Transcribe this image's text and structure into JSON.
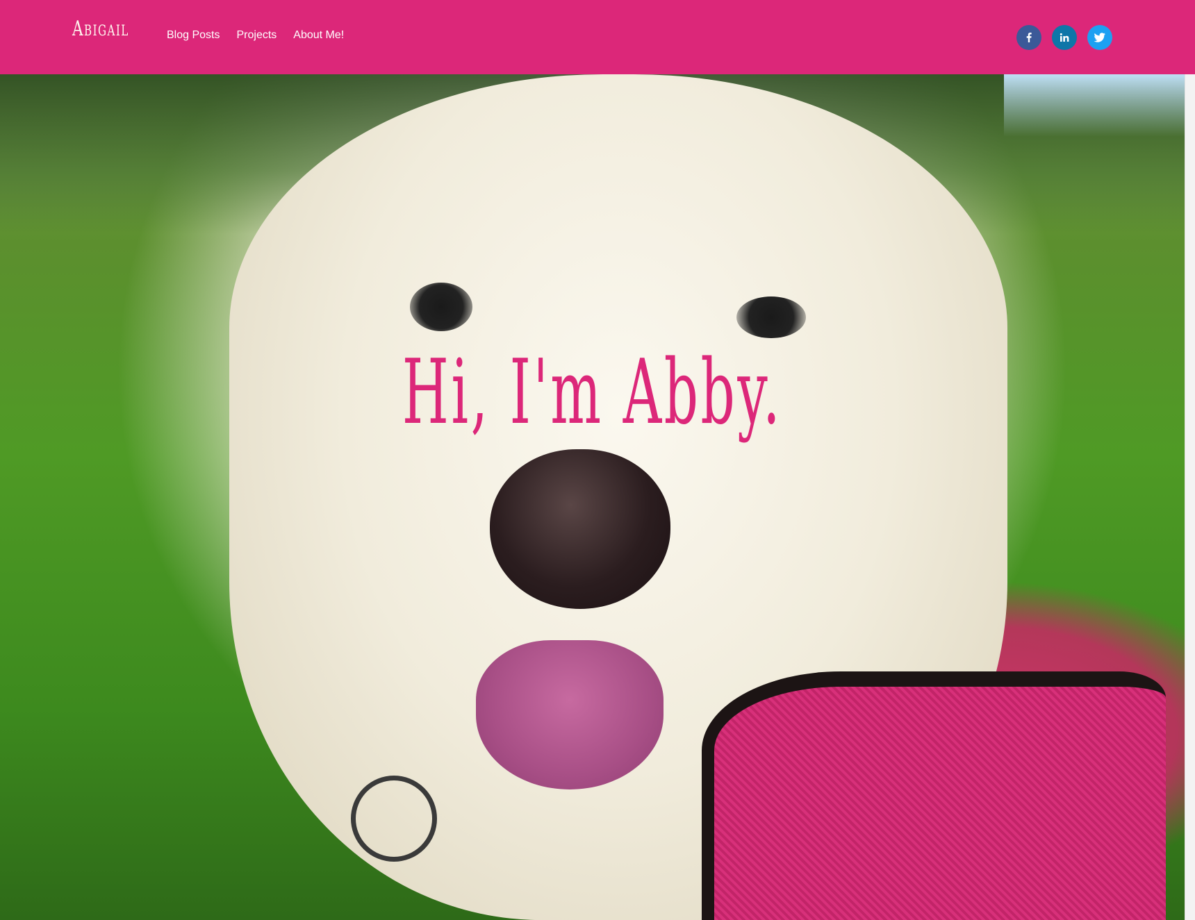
{
  "header": {
    "brand": "Abigail",
    "nav": [
      {
        "label": "Blog Posts"
      },
      {
        "label": "Projects"
      },
      {
        "label": "About Me!"
      }
    ],
    "social": [
      {
        "name": "facebook-icon",
        "color": "#3b5998"
      },
      {
        "name": "linkedin-icon",
        "color": "#0e76a8"
      },
      {
        "name": "twitter-icon",
        "color": "#1da1f2"
      }
    ]
  },
  "hero": {
    "title": "Hi, I'm Abby."
  },
  "colors": {
    "accent": "#dc2779",
    "nav_text": "#ffffff"
  }
}
